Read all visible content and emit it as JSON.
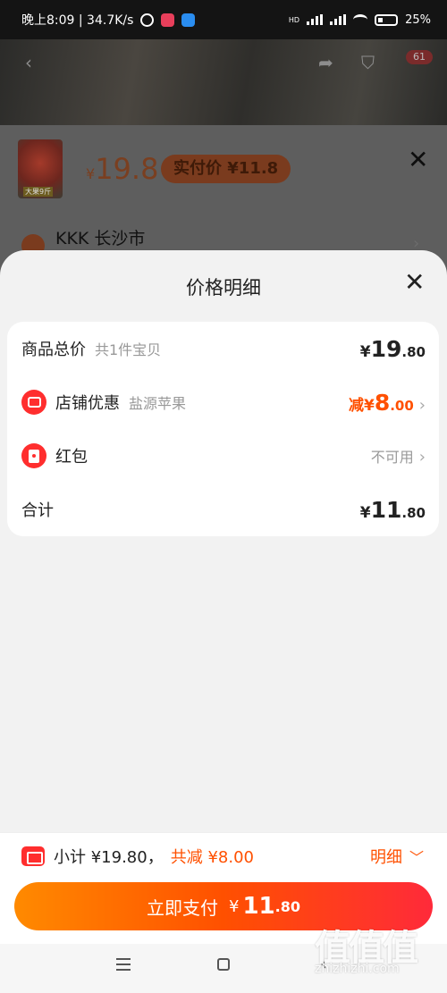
{
  "status_bar": {
    "time_speed": "晚上8:09 | 34.7K/s",
    "battery": "25%",
    "net_label": "HD"
  },
  "background_page": {
    "price_symbol": "¥",
    "price": "19.8",
    "actual_price": "实付价 ¥11.8",
    "cart_badge": "61",
    "location": "KKK 长沙市",
    "thumb_text": "大果9斤"
  },
  "sheet": {
    "title": "价格明细",
    "rows": {
      "total": {
        "label": "商品总价",
        "sub": "共1件宝贝",
        "yen": "¥",
        "int": "19",
        "cents": ".80"
      },
      "store_discount": {
        "label": "店铺优惠",
        "sub": "盐源苹果",
        "prefix": "减¥",
        "int": "8",
        "cents": ".00"
      },
      "red_packet": {
        "label": "红包",
        "value": "不可用"
      },
      "sum": {
        "label": "合计",
        "yen": "¥",
        "int": "11",
        "cents": ".80"
      }
    }
  },
  "footer": {
    "subtotal": "小计 ¥19.80，",
    "discount": "共减 ¥8.00",
    "detail": "明细",
    "pay_label": "立即支付",
    "pay_yen": "¥",
    "pay_int": "11",
    "pay_cents": ".80"
  },
  "watermark": {
    "logo": "值值值",
    "site": "zhizhizhi.com"
  },
  "colors": {
    "accent": "#ff5000",
    "badge_red": "#ff2e2e"
  }
}
